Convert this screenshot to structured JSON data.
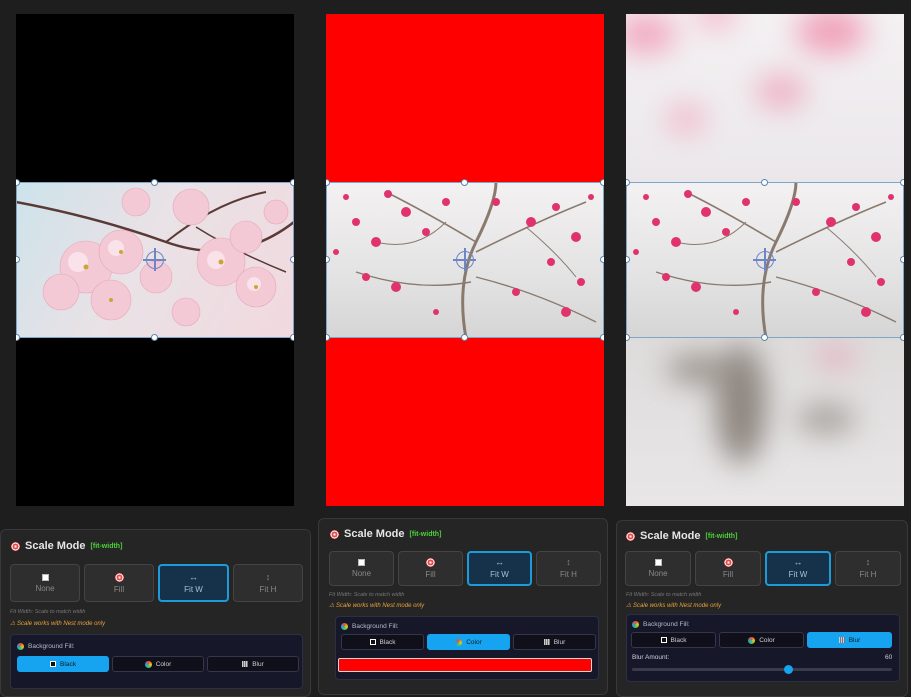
{
  "colors": {
    "accent": "#16a3ef",
    "active_mode_border": "#1d9bd9",
    "tag_green": "#4cd137",
    "warning": "#e8a23a",
    "fill_red": "#ff0000"
  },
  "previews": [
    {
      "background_fill": "black"
    },
    {
      "background_fill": "color"
    },
    {
      "background_fill": "blur"
    }
  ],
  "panels": [
    {
      "title": "Scale Mode",
      "tag": "[fit-width]",
      "modes": [
        {
          "label": "None",
          "icon": "square-icon"
        },
        {
          "label": "Fill",
          "icon": "target-icon"
        },
        {
          "label": "Fit W",
          "icon": "arrows-horizontal-icon"
        },
        {
          "label": "Fit H",
          "icon": "arrows-vertical-icon"
        }
      ],
      "active_mode": "Fit W",
      "hint": "Fit Width: Scale to match width",
      "warning": "⚠ Scale works with Nest mode only",
      "bg_fill_label": "Background Fill:",
      "bg_options": [
        "Black",
        "Color",
        "Blur"
      ],
      "bg_active": "Black"
    },
    {
      "title": "Scale Mode",
      "tag": "[fit-width]",
      "modes": [
        {
          "label": "None",
          "icon": "square-icon"
        },
        {
          "label": "Fill",
          "icon": "target-icon"
        },
        {
          "label": "Fit W",
          "icon": "arrows-horizontal-icon"
        },
        {
          "label": "Fit H",
          "icon": "arrows-vertical-icon"
        }
      ],
      "active_mode": "Fit W",
      "hint": "Fit Width: Scale to match width",
      "warning": "⚠ Scale works with Nest mode only",
      "bg_fill_label": "Background Fill:",
      "bg_options": [
        "Black",
        "Color",
        "Blur"
      ],
      "bg_active": "Color",
      "color_value": "#ff0000"
    },
    {
      "title": "Scale Mode",
      "tag": "[fit-width]",
      "modes": [
        {
          "label": "None",
          "icon": "square-icon"
        },
        {
          "label": "Fill",
          "icon": "target-icon"
        },
        {
          "label": "Fit W",
          "icon": "arrows-horizontal-icon"
        },
        {
          "label": "Fit H",
          "icon": "arrows-vertical-icon"
        }
      ],
      "active_mode": "Fit W",
      "hint": "Fit Width: Scale to match width",
      "warning": "⚠ Scale works with Nest mode only",
      "bg_fill_label": "Background Fill:",
      "bg_options": [
        "Black",
        "Color",
        "Blur"
      ],
      "bg_active": "Blur",
      "blur_label": "Blur Amount:",
      "blur_value": "60",
      "blur_fraction": 0.6
    }
  ]
}
